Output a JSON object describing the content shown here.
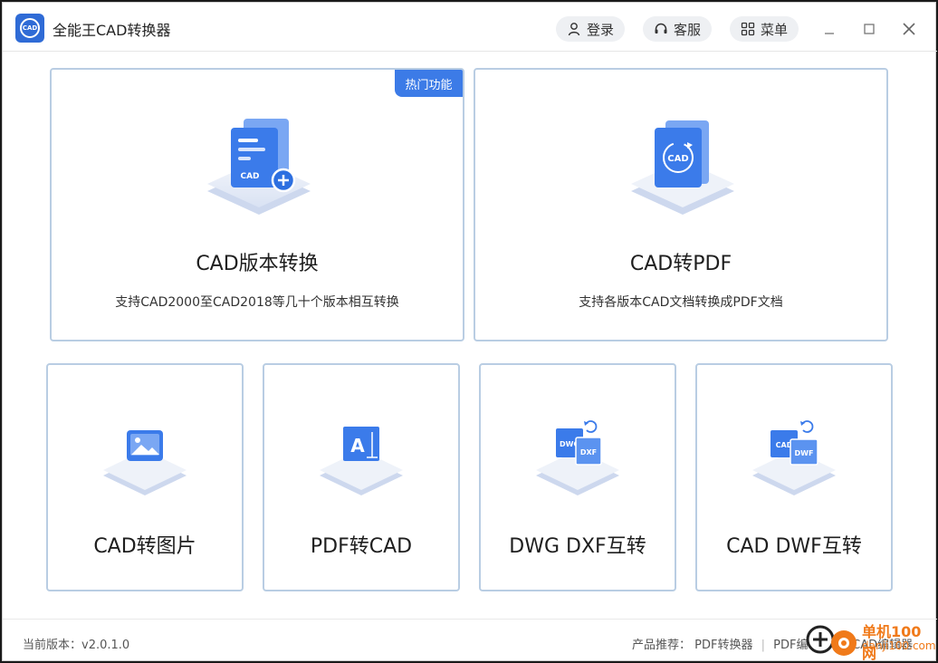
{
  "app": {
    "logo_text": "CAD",
    "title": "全能王CAD转换器"
  },
  "header": {
    "login_label": "登录",
    "service_label": "客服",
    "menu_label": "菜单"
  },
  "cards": {
    "version_convert": {
      "badge": "热门功能",
      "title": "CAD版本转换",
      "desc": "支持CAD2000至CAD2018等几十个版本相互转换",
      "icon_text": "CAD"
    },
    "cad_to_pdf": {
      "title": "CAD转PDF",
      "desc": "支持各版本CAD文档转换成PDF文档",
      "icon_text": "CAD"
    },
    "cad_to_image": {
      "title": "CAD转图片"
    },
    "pdf_to_cad": {
      "title": "PDF转CAD",
      "icon_text": "A"
    },
    "dwg_dxf": {
      "title": "DWG DXF互转",
      "icon_text_a": "DWG",
      "icon_text_b": "DXF"
    },
    "cad_dwf": {
      "title": "CAD DWF互转",
      "icon_text_a": "CAD",
      "icon_text_b": "DWF"
    }
  },
  "footer": {
    "version_label": "当前版本：",
    "version_value": "v2.0.1.0",
    "recommend_label": "产品推荐：",
    "recommend_links": [
      "PDF转换器",
      "PDF编辑器",
      "CAD编辑器"
    ]
  },
  "watermark": {
    "top_text": "单机100网",
    "bottom_text": "danji100.com"
  },
  "colors": {
    "accent": "#3c7be7",
    "card_border": "#b9cde3",
    "icon_blue": "#3b7bea"
  }
}
